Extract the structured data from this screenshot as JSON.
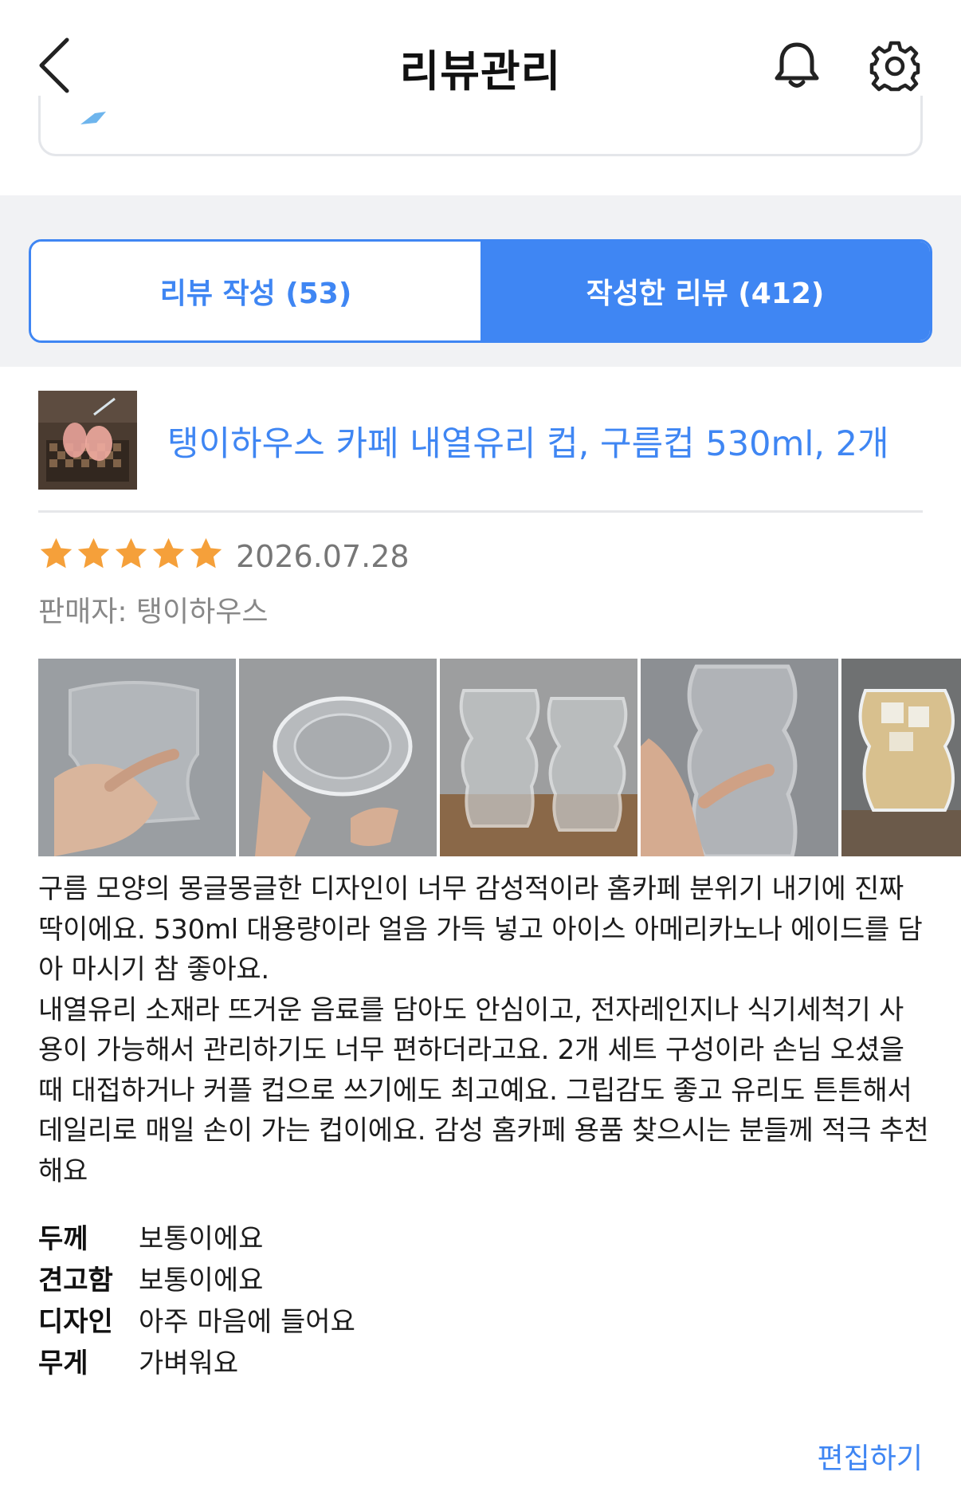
{
  "header": {
    "title": "리뷰관리",
    "back_icon": "chevron-left-icon",
    "bell_icon": "bell-icon",
    "settings_icon": "gear-icon"
  },
  "tabs": {
    "write_label": "리뷰 작성 (53)",
    "written_label": "작성한 리뷰 (412)",
    "active": "written"
  },
  "review": {
    "product_name": "탱이하우스 카페 내열유리 컵, 구름컵 530ml, 2개",
    "rating": 5,
    "rating_max": 5,
    "date": "2026.07.28",
    "seller": "판매자: 탱이하우스",
    "photo_count_visible": 5,
    "text": "구름 모양의 몽글몽글한 디자인이 너무 감성적이라 홈카페 분위기 내기에 진짜\n딱이에요. 530ml 대용량이라 얼음 가득 넣고 아이스 아메리카노나 에이드를 담\n아 마시기 참 좋아요.\n내열유리 소재라 뜨거운 음료를 담아도 안심이고, 전자레인지나 식기세척기 사\n용이 가능해서 관리하기도 너무 편하더라고요. 2개 세트 구성이라 손님 오셨을\n때 대접하거나 커플 컵으로 쓰기에도 최고예요. 그립감도 좋고 유리도 튼튼해서\n데일리로 매일 손이 가는 컵이에요. 감성 홈카페 용품 찾으시는 분들께 적극 추천\n해요",
    "attributes": [
      {
        "key": "두께",
        "value": "보통이에요"
      },
      {
        "key": "견고함",
        "value": "보통이에요"
      },
      {
        "key": "디자인",
        "value": "아주 마음에 들어요"
      },
      {
        "key": "무게",
        "value": "가벼워요"
      }
    ],
    "edit_label": "편집하기"
  },
  "colors": {
    "accent": "#3f86f3",
    "star": "#f5a03a",
    "band": "#f1f2f4"
  }
}
